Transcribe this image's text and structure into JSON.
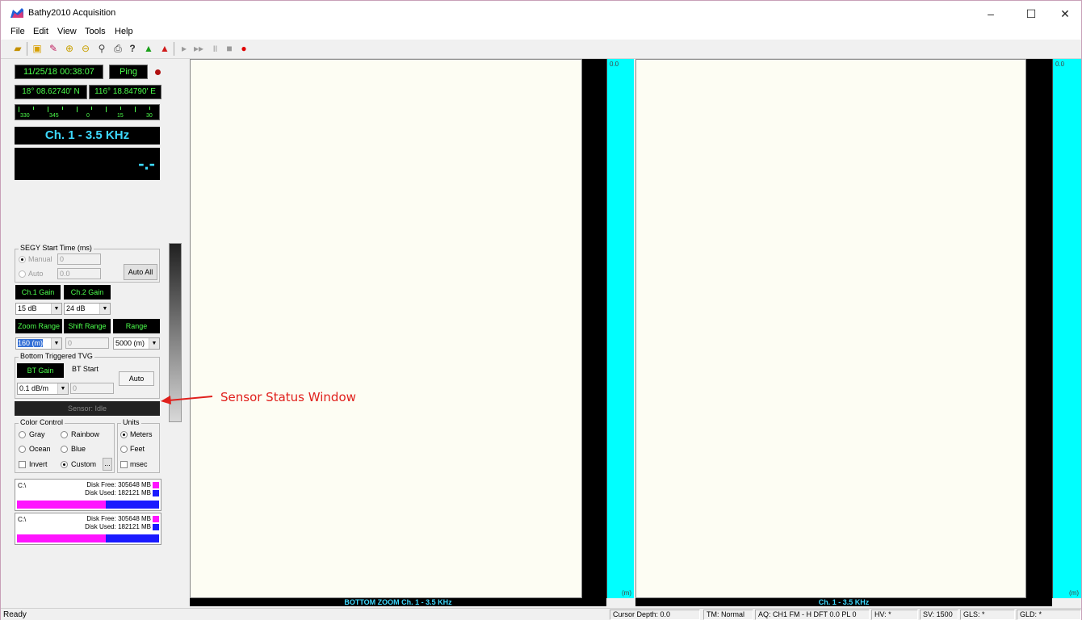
{
  "window": {
    "title": "Bathy2010 Acquisition",
    "controls": [
      "–",
      "☐",
      "✕"
    ]
  },
  "menu": [
    "File",
    "Edit",
    "View",
    "Tools",
    "Help"
  ],
  "toolbar": {
    "icons": [
      "open-folder-icon",
      "camera-icon",
      "pen-icon",
      "zoom-in-icon",
      "zoom-out-icon",
      "magnify-icon",
      "print-icon",
      "help-icon",
      "ship-green-icon",
      "ship-red-icon",
      "play-icon",
      "fast-forward-icon",
      "pause-icon",
      "stop-icon",
      "record-icon"
    ]
  },
  "nav": {
    "datetime": "11/25/18 00:38:07",
    "ping_label": "Ping",
    "latitude": "18° 08.62740' N",
    "longitude": "116° 18.84790' E",
    "compass_labels": [
      "330",
      "345",
      "0",
      "15",
      "30"
    ],
    "channel": "Ch. 1 - 3.5 KHz",
    "depth": "-.-"
  },
  "segy": {
    "title": "SEGY Start Time (ms)",
    "manual_label": "Manual",
    "manual_value": "0",
    "auto_label": "Auto",
    "auto_value": "0.0",
    "auto_all_button": "Auto All"
  },
  "gain": {
    "ch1_label": "Ch.1 Gain",
    "ch2_label": "Ch.2 Gain",
    "ch1_value": "15 dB",
    "ch2_value": "24 dB"
  },
  "range": {
    "zoom_label": "Zoom Range",
    "shift_label": "Shift Range",
    "range_label": "Range",
    "zoom_value": "160 (m)",
    "shift_value": "0",
    "range_value": "5000 (m)"
  },
  "tvg": {
    "title": "Bottom Triggered TVG",
    "bt_gain_label": "BT Gain",
    "bt_start_label": "BT Start",
    "auto_button": "Auto",
    "bt_gain_value": "0.1 dB/m",
    "bt_start_value": "0"
  },
  "sensor": {
    "status": "Sensor: Idle"
  },
  "color_control": {
    "title": "Color Control",
    "options": [
      "Gray",
      "Rainbow",
      "Ocean",
      "Blue"
    ],
    "invert_label": "Invert",
    "custom_label": "Custom",
    "custom_button": "..."
  },
  "units": {
    "title": "Units",
    "options": [
      "Meters",
      "Feet"
    ],
    "msec_label": "msec"
  },
  "disks": [
    {
      "drive": "C:\\",
      "free_label": "Disk Free: 305648 MB",
      "used_label": "Disk Used: 182121 MB",
      "free_fraction": 0.627
    },
    {
      "drive": "C:\\",
      "free_label": "Disk Free: 305648 MB",
      "used_label": "Disk Used: 182121 MB",
      "free_fraction": 0.627
    }
  ],
  "colors": {
    "lcd_green": "#4cff4c",
    "lcd_cyan": "#3dd9ff",
    "scale_cyan": "#00ffff",
    "disk_free": "#ff14ff",
    "disk_used": "#1a1aff",
    "annotation_red": "#e0201c"
  },
  "panes": {
    "left_scale_top": "0.0",
    "left_scale_unit": "(m)",
    "left_caption": "BOTTOM ZOOM Ch. 1 - 3.5 KHz",
    "right_scale_top": "0.0",
    "right_scale_unit": "(m)",
    "right_caption": "Ch. 1 - 3.5 KHz"
  },
  "annotation": {
    "text": "Sensor Status Window"
  },
  "statusbar": {
    "ready": "Ready",
    "cursor_depth": "Cursor Depth: 0.0",
    "tm": "TM: Normal",
    "aq": "AQ: CH1 FM - H DFT 0.0 PL 0",
    "hv": "HV: *",
    "sv": "SV: 1500",
    "gls": "GLS: *",
    "gld": "GLD: *"
  }
}
